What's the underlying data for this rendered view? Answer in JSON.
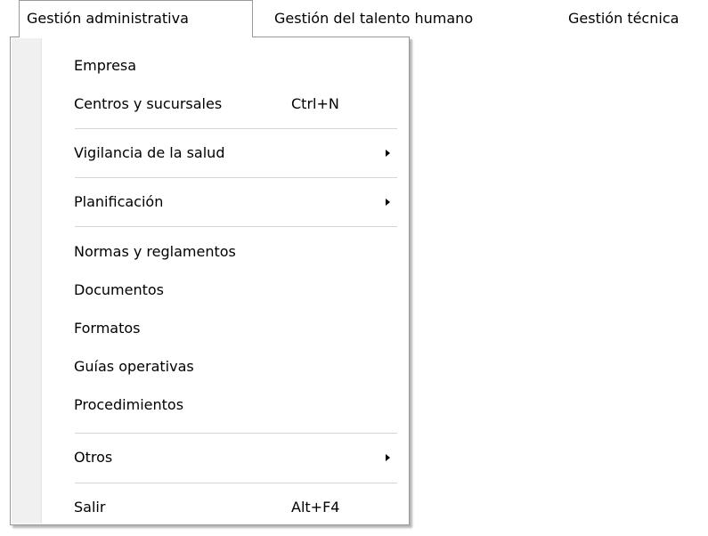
{
  "menubar": {
    "items": [
      {
        "label": "Gestión administrativa",
        "open": true
      },
      {
        "label": "Gestión del talento humano"
      },
      {
        "label": "Gestión técnica"
      }
    ]
  },
  "dropdown": {
    "items": [
      {
        "label": "Empresa"
      },
      {
        "label": "Centros y sucursales",
        "shortcut": "Ctrl+N"
      },
      {
        "label": "Vigilancia de la salud",
        "submenu": true
      },
      {
        "label": "Planificación",
        "submenu": true
      },
      {
        "label": "Normas y reglamentos"
      },
      {
        "label": "Documentos"
      },
      {
        "label": "Formatos"
      },
      {
        "label": "Guías operativas"
      },
      {
        "label": "Procedimientos"
      },
      {
        "label": "Otros",
        "submenu": true
      },
      {
        "label": "Salir",
        "shortcut": "Alt+F4"
      }
    ]
  }
}
